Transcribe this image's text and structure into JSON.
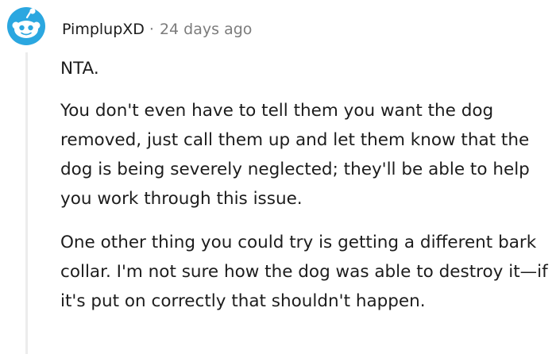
{
  "comment": {
    "avatar_icon": "reddit-snoo-avatar-icon",
    "username": "PimplupXD",
    "separator": "·",
    "timestamp": "24 days ago",
    "paragraphs": [
      "NTA.",
      "You don't even have to tell them you want the dog removed, just call them up and let them know that the dog is being severely neglected; they'll be able to help you work through this issue.",
      "One other thing you could try is getting a different bark collar. I'm not sure how the dog was able to destroy it—if it's put on correctly that shouldn't happen."
    ]
  },
  "colors": {
    "avatar_blue": "#2ba7e0",
    "text": "#1c1c1c",
    "meta": "#7c7c7c",
    "thread_line": "#ececec"
  }
}
